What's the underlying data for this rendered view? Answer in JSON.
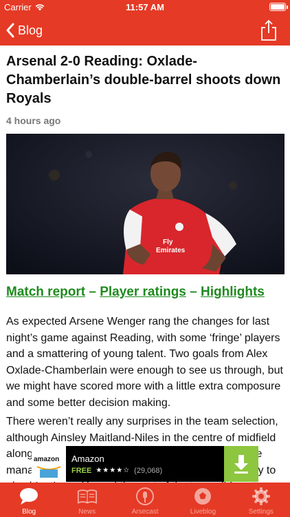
{
  "status_bar": {
    "carrier": "Carrier",
    "time": "11:57 AM"
  },
  "nav": {
    "back_label": "Blog"
  },
  "article": {
    "title": "Arsenal 2-0 Reading: Oxlade-Chamberlain’s double-barrel shoots down Royals",
    "time_ago": "4 hours ago",
    "links": {
      "match_report": "Match report",
      "sep1": " – ",
      "player_ratings": "Player ratings",
      "sep2": " – ",
      "highlights": "Highlights"
    },
    "paragraph1": "As expected Arsene Wenger rang the changes for last night’s game against Reading, with some ‘fringe’ players and a smattering of young talent. Two goals from Alex Oxlade-Chamberlain were enough to see us through, but we might have scored more with a little extra composure and some better decision making.",
    "paragraph2": "There weren’t really any surprises in the team selection, although Ainsley Maitland-Niles in the centre of midfield alongside Mohamed Elneny was a little left field. The manager has clearly been impressed and was happy to play him there. He and the rest of the team did pretty well"
  },
  "ad": {
    "logo_text": "amazon",
    "title": "Amazon",
    "price": "FREE",
    "stars": "★★★★☆",
    "rating_count": "(29,068)"
  },
  "tabs": [
    {
      "label": "Blog",
      "active": true
    },
    {
      "label": "News",
      "active": false
    },
    {
      "label": "Arsecast",
      "active": false
    },
    {
      "label": "Liveblog",
      "active": false
    },
    {
      "label": "Settings",
      "active": false
    }
  ],
  "colors": {
    "brand_red": "#e53a25",
    "link_green": "#1f8a1f",
    "ad_green": "#8dc63f"
  }
}
